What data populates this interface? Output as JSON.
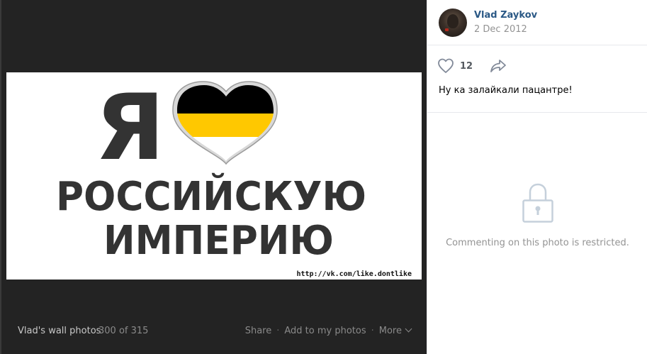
{
  "photo": {
    "headline_letter": "Я",
    "line_1": "РОССИЙСКУЮ",
    "line_2": "ИМПЕРИЮ",
    "watermark": "http://vk.com/like.dontlike",
    "flag_colors": [
      "#000000",
      "#ffc800",
      "#ffffff"
    ]
  },
  "bottom_bar": {
    "album_title": "Vlad's wall photos",
    "counter": "300 of 315",
    "share_label": "Share",
    "add_label": "Add to my photos",
    "more_label": "More"
  },
  "author": {
    "name": "Vlad Zaykov",
    "date": "2 Dec 2012"
  },
  "reactions": {
    "like_count": "12",
    "like_icon": "heart-outline-icon",
    "share_icon": "share-arrow-icon"
  },
  "caption": "Ну ка залайкали пацантре!",
  "comments": {
    "restricted_message": "Commenting on this photo is restricted.",
    "icon": "lock-icon"
  },
  "colors": {
    "link": "#2a5885",
    "dark_background": "#232323",
    "muted_text": "#939393"
  }
}
